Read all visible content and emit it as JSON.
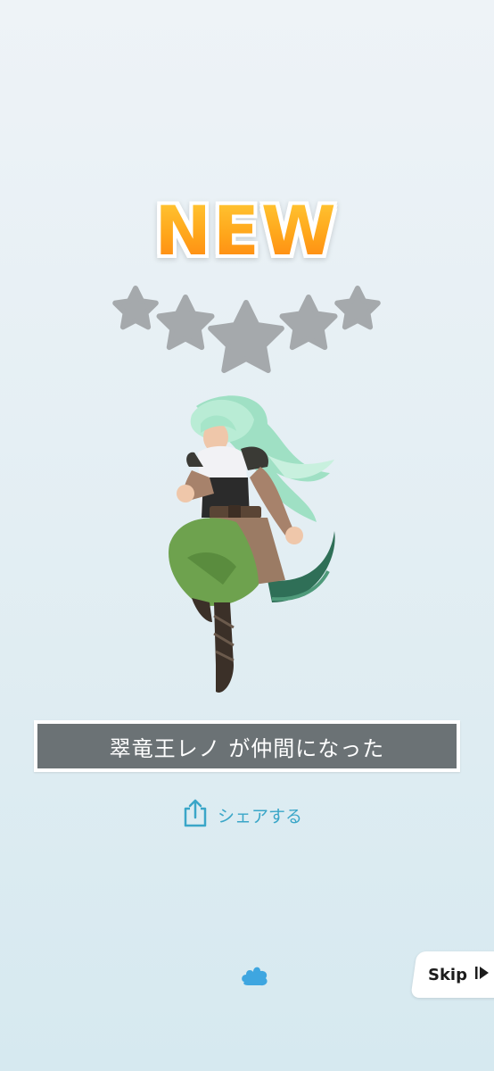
{
  "header": {
    "badge_text": "NEW"
  },
  "rarity": {
    "max_stars": 5,
    "filled_stars": 0,
    "star_color": "#a5a9ac"
  },
  "character": {
    "message": "翠竜王レノ が仲間になった"
  },
  "share": {
    "label": "シェアする",
    "icon": "share-icon"
  },
  "skip": {
    "label": "Skip",
    "icon": "skip-play-icon"
  },
  "colors": {
    "accent": "#3aa6c8",
    "banner_bg": "#6b7275",
    "new_orange": "#ffa51a"
  }
}
